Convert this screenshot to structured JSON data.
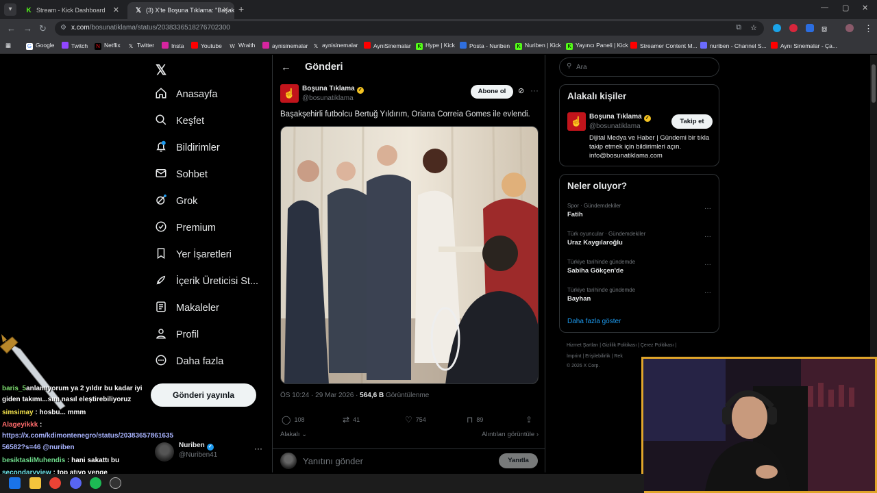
{
  "browser": {
    "tabs": [
      {
        "title": "Stream - Kick Dashboard",
        "active": false
      },
      {
        "title": "(3) X'te Boşuna Tıklama: \"Başak",
        "active": true
      }
    ],
    "url_host": "x.com",
    "url_path": "/bosunatiklama/status/2038336518276702300",
    "bookmarks": [
      "Google",
      "Twitch",
      "Netflix",
      "Twitter",
      "Insta",
      "Youtube",
      "Wraith",
      "aynisinemalar",
      "aynisinemalar",
      "AyniSinemalar",
      "Hype | Kick",
      "Posta - Nuriben",
      "Nuriben | Kick",
      "Yayıncı Paneli | Kick",
      "Streamer Content M...",
      "nuriben - Channel S...",
      "Aynı Sinemalar - Ça..."
    ]
  },
  "nav": {
    "items": [
      "Anasayfa",
      "Keşfet",
      "Bildirimler",
      "Sohbet",
      "Grok",
      "Premium",
      "Yer İşaretleri",
      "İçerik Üreticisi St...",
      "Makaleler",
      "Profil",
      "Daha fazla"
    ],
    "notif_badge": "3",
    "post_button": "Gönderi yayınla",
    "account_name": "Nuriben",
    "account_handle": "@Nuriben41"
  },
  "main": {
    "header": "Gönderi",
    "author_name": "Boşuna Tıklama",
    "author_handle": "@bosunatiklama",
    "subscribe": "Abone ol",
    "text": "Başakşehirli futbolcu Bertuğ Yıldırım, Oriana Correia Gomes ile evlendi.",
    "time": "ÖS 10:24 · 29 Mar 2026 · ",
    "views": "564,6 B",
    "views_label": " Görüntülenme",
    "replies": "108",
    "reposts": "41",
    "likes": "754",
    "bookmarks": "89",
    "related": "Alakalı",
    "quotes": "Alıntıları görüntüle",
    "reply_placeholder": "Yanıtını gönder",
    "reply_button": "Yanıtla"
  },
  "right": {
    "search_placeholder": "Ara",
    "related_title": "Alakalı kişiler",
    "person_name": "Boşuna Tıklama",
    "person_handle": "@bosunatiklama",
    "follow": "Takip et",
    "bio": "Dijital Medya ve Haber | Gündemi bir tıkla takip etmek için bildirimleri açın. info@bosunatiklama.com",
    "trends_title": "Neler oluyor?",
    "trends": [
      {
        "cat": "Spor · Gündemdekiler",
        "name": "Fatih"
      },
      {
        "cat": "Türk oyuncular · Gündemdekiler",
        "name": "Uraz Kaygılaroğlu"
      },
      {
        "cat": "Türkiye tarihinde gündemde",
        "name": "Sabiha Gökçen'de"
      },
      {
        "cat": "Türkiye tarihinde gündemde",
        "name": "Bayhan"
      }
    ],
    "show_more": "Daha fazla göster",
    "footer1": "Hizmet Şartları  |  Gizlilik Politikası  |  Çerez Politikası  |",
    "footer2": "İmprint  |  Erişilebilirlik  |  Rek",
    "footer3": "© 2026 X Corp."
  },
  "chat": [
    {
      "user": "baris_5",
      "user_color": "#7ddc6f",
      "text": "anlamıyorum ya 2 yıldır bu kadar iyi"
    },
    {
      "user": "",
      "user_color": "#ffffff",
      "text": "giden takımı...sını nasıl eleştirebiliyoruz"
    },
    {
      "user": "simsimay",
      "user_color": "#f2e14c",
      "text": ": hosbu... mmm"
    },
    {
      "user": "Alageyikkk",
      "user_color": "#ff6b6b",
      "text": " :"
    },
    {
      "user": "",
      "user_color": "#ffffff",
      "text": "https://x.com/kdimontenegro/status/20383657861635"
    },
    {
      "user": "",
      "user_color": "#ffffff",
      "text": "56582?s=46 @nuriben"
    },
    {
      "user": "besiktasliMuhendis",
      "user_color": "#6fdc8c",
      "text": " : hani sakattı bu"
    },
    {
      "user": "secondaryview",
      "user_color": "#6fe3e8",
      "text": " : top atıyo yenge"
    }
  ]
}
